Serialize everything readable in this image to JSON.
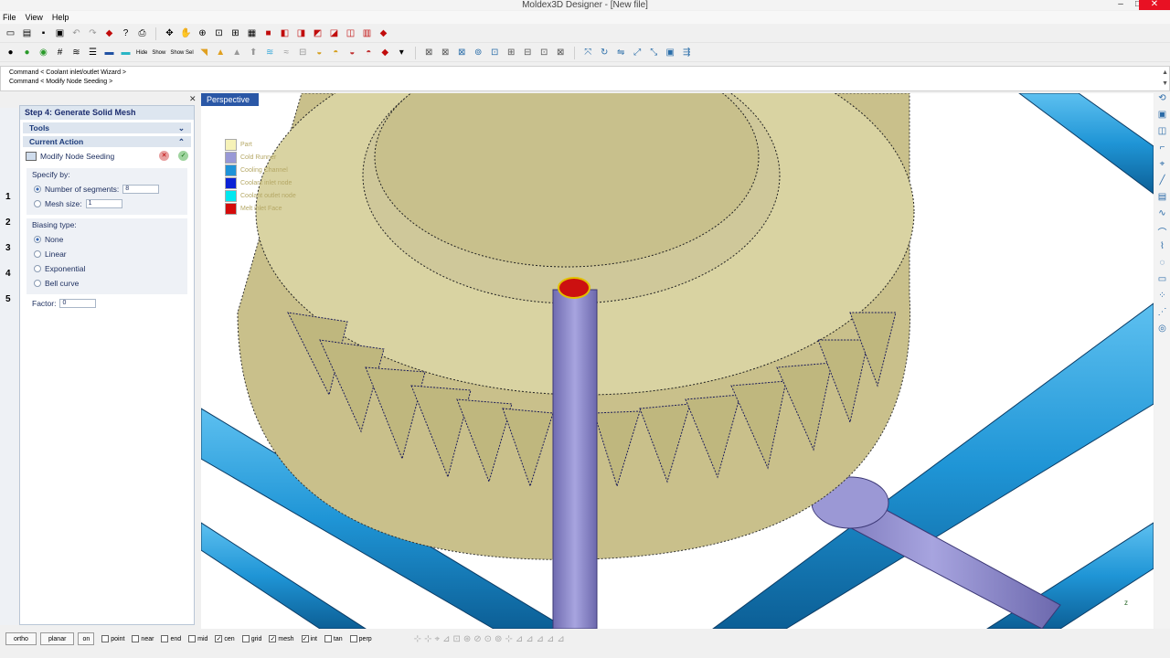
{
  "window": {
    "title": "Moldex3D Designer - [New file]",
    "minimize": "–",
    "maximize": "□",
    "close": "✕"
  },
  "menu": [
    "File",
    "View",
    "Help"
  ],
  "command_log": [
    "Command < Coolant inlet/outlet Wizard >",
    "Command < Modify Node Seeding >"
  ],
  "wizard": {
    "step_title": "Step 4: Generate Solid Mesh",
    "step_numbers": [
      "1",
      "2",
      "3",
      "4",
      "5"
    ],
    "tools_label": "Tools",
    "current_action_label": "Current Action",
    "action_name": "Modify Node Seeding",
    "specify_by": {
      "title": "Specify by:",
      "number_of_segments_label": "Number of segments:",
      "number_of_segments_value": "8",
      "mesh_size_label": "Mesh size:",
      "mesh_size_value": "1"
    },
    "biasing": {
      "title": "Biasing type:",
      "options": [
        "None",
        "Linear",
        "Exponential",
        "Bell curve"
      ],
      "selected": "None",
      "factor_label": "Factor:",
      "factor_value": "0"
    }
  },
  "viewport": {
    "label": "Perspective",
    "legend": [
      {
        "label": "Part",
        "color": "#f6f2b8"
      },
      {
        "label": "Cold Runner",
        "color": "#9898d6"
      },
      {
        "label": "Cooling Channel",
        "color": "#1e93d8"
      },
      {
        "label": "Coolant inlet node",
        "color": "#0b22d6"
      },
      {
        "label": "Coolant outlet node",
        "color": "#00e8f0"
      },
      {
        "label": "Melt inlet Face",
        "color": "#d40a0a"
      }
    ],
    "colors": {
      "part": "#c8c08a",
      "part_top": "#d9d3a2",
      "runner": "#8c88c4",
      "cooling_channel": "#1f95d6",
      "melt_inlet": "#cc1010"
    }
  },
  "statusbar": {
    "buttons": [
      "ortho",
      "planar"
    ],
    "toggles": [
      {
        "label": "on",
        "checked": false
      },
      {
        "label": "point",
        "checked": false
      },
      {
        "label": "near",
        "checked": false
      },
      {
        "label": "end",
        "checked": false
      },
      {
        "label": "mid",
        "checked": false
      },
      {
        "label": "cen",
        "checked": true
      },
      {
        "label": "grid",
        "checked": false
      },
      {
        "label": "mesh",
        "checked": true
      },
      {
        "label": "int",
        "checked": true
      },
      {
        "label": "tan",
        "checked": false
      },
      {
        "label": "perp",
        "checked": false
      }
    ]
  }
}
